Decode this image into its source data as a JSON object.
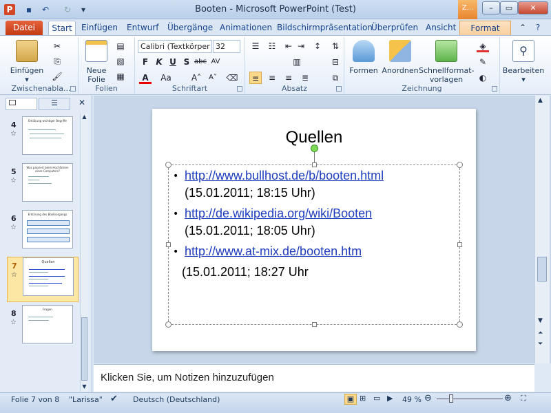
{
  "window": {
    "title": "Booten - Microsoft PowerPoint (Test)",
    "context_tab_top": "Z..."
  },
  "tabs": [
    "Datei",
    "Start",
    "Einfügen",
    "Entwurf",
    "Übergänge",
    "Animationen",
    "Bildschirmpräsentation",
    "Überprüfen",
    "Ansicht",
    "Format"
  ],
  "ribbon": {
    "clipboard": {
      "paste": "Einfügen",
      "label": "Zwischenabla..."
    },
    "slides": {
      "new_slide_line1": "Neue",
      "new_slide_line2": "Folie",
      "label": "Folien"
    },
    "font": {
      "name": "Calibri (Textkörper",
      "size": "32",
      "label": "Schriftart"
    },
    "paragraph": {
      "label": "Absatz"
    },
    "drawing": {
      "shapes": "Formen",
      "arrange": "Anordnen",
      "quickstyles_line1": "Schnellformat-",
      "quickstyles_line2": "vorlagen",
      "label": "Zeichnung"
    },
    "editing": {
      "label": "Bearbeiten"
    }
  },
  "slides_pane": {
    "items": [
      {
        "num": "4",
        "title": "Erklärung wichtiger Begriffe"
      },
      {
        "num": "5",
        "title": "Was passiert beim Hochfahren eines Computers?"
      },
      {
        "num": "6",
        "title": "Erklärung des Bootvorgangs"
      },
      {
        "num": "7",
        "title": "Quellen"
      },
      {
        "num": "8",
        "title": "Fragen"
      }
    ]
  },
  "slide": {
    "title": "Quellen",
    "items": [
      {
        "link": "http://www.bullhost.de/b/booten.html",
        "date": "(15.01.2011; 18:15 Uhr)"
      },
      {
        "link": "http://de.wikipedia.org/wiki/Booten",
        "date": "(15.01.2011; 18:05 Uhr)"
      },
      {
        "link": "http://www.at-mix.de/booten.htm",
        "date": "(15.01.2011; 18:27 Uhr"
      }
    ]
  },
  "notes": {
    "placeholder": "Klicken Sie, um Notizen hinzuzufügen"
  },
  "status": {
    "slide": "Folie 7 von 8",
    "theme": "\"Larissa\"",
    "language": "Deutsch (Deutschland)",
    "zoom": "49 %"
  }
}
